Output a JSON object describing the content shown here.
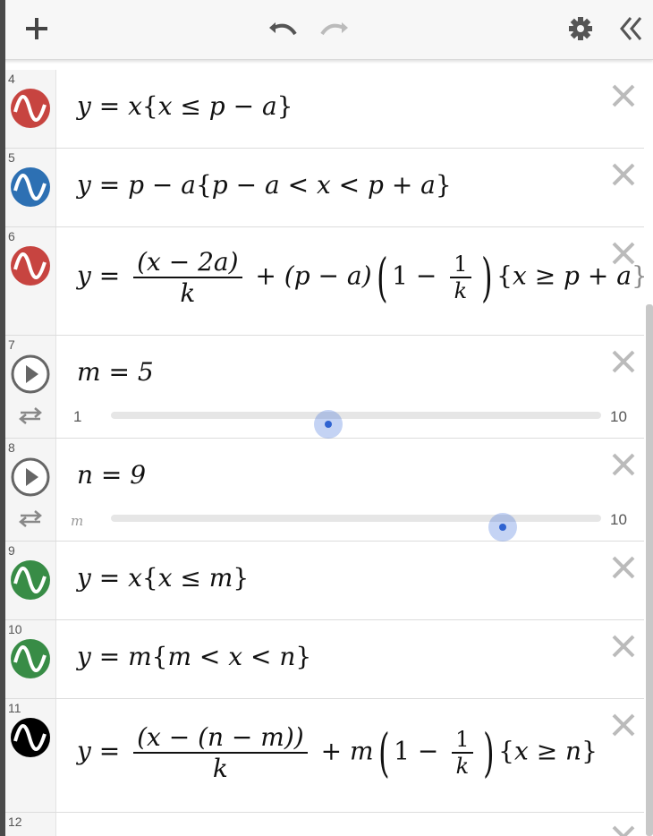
{
  "toolbar": {
    "add_icon": "plus-icon",
    "undo_icon": "undo-icon",
    "redo_icon": "redo-icon",
    "settings_icon": "gear-icon",
    "collapse_icon": "double-chevron-left-icon"
  },
  "colors": {
    "red": "#c74440",
    "blue": "#2d70b3",
    "green": "#388c46",
    "black": "#000000",
    "slider_thumb": "#2f63d1"
  },
  "rows": [
    {
      "index": "4",
      "color": "red"
    },
    {
      "index": "5",
      "color": "blue"
    },
    {
      "index": "6",
      "color": "red"
    },
    {
      "index": "7",
      "slider": {
        "variable": "m",
        "value": "5",
        "min": "1",
        "max": "10",
        "fraction": 0.444
      }
    },
    {
      "index": "8",
      "slider": {
        "variable": "n",
        "value": "9",
        "min": "m",
        "max": "10",
        "fraction": 0.8
      }
    },
    {
      "index": "9",
      "color": "green"
    },
    {
      "index": "10",
      "color": "green"
    },
    {
      "index": "11",
      "color": "black"
    },
    {
      "index": "12"
    }
  ],
  "expr": {
    "r4": {
      "lhs": "y = x",
      "cond": "x ≤ p − a"
    },
    "r5": {
      "lhs": "y = p − a",
      "cond": "p − a < x < p + a"
    },
    "r6": {
      "num": "(x − 2a)",
      "den": "k",
      "mid": "+ (p − a)",
      "one": "1 −",
      "fnum": "1",
      "fden": "k",
      "cond": "x ≥ p + a"
    },
    "r7": {
      "text": "m = 5"
    },
    "r8": {
      "text": "n = 9"
    },
    "r9": {
      "lhs": "y = x",
      "cond": "x ≤ m"
    },
    "r10": {
      "lhs": "y = m",
      "cond": "m < x < n"
    },
    "r11": {
      "num": "(x − (n − m))",
      "den": "k",
      "mid": "+ m",
      "one": "1 −",
      "fnum": "1",
      "fden": "k",
      "cond": "x ≥ n"
    }
  },
  "labels": {
    "y_eq": "y ="
  }
}
